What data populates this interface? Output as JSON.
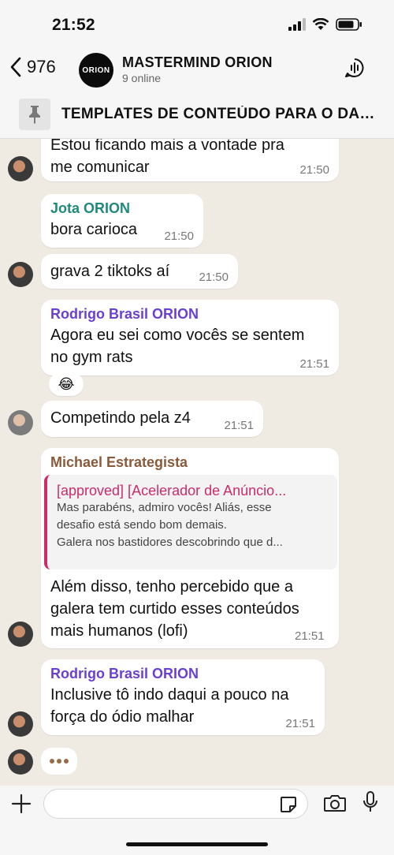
{
  "status": {
    "time": "21:52"
  },
  "header": {
    "back_count": "976",
    "group_avatar_label": "ORION",
    "group_name": "MASTERMIND ORION",
    "online": "9 online"
  },
  "pinned": {
    "text": "TEMPLATES DE CONTEÚDO PARA O DAS..."
  },
  "messages": [
    {
      "text_line1": "Estou ficando mais a vontade pra",
      "text_line2": "me comunicar",
      "time": "21:50"
    },
    {
      "sender": "Jota ORION",
      "text": "bora carioca",
      "time": "21:50"
    },
    {
      "text": "grava 2 tiktoks aí",
      "time": "21:50"
    },
    {
      "sender": "Rodrigo Brasil ORION",
      "text_line1": "Agora eu sei como vocês se sentem",
      "text_line2": "no gym rats",
      "time": "21:51"
    },
    {
      "reaction": "😂"
    },
    {
      "text": "Competindo pela z4",
      "time": "21:51"
    },
    {
      "sender": "Michael Estrategista",
      "reply_title": "[approved] [Acelerador de Anúncio...",
      "reply_line1": "Mas parabéns, admiro vocês! Aliás, esse",
      "reply_line2": "desafio está sendo bom demais.",
      "reply_line3": "Galera nos bastidores descobrindo que d...",
      "text_line1": "Além disso, tenho percebido que a",
      "text_line2": "galera tem curtido esses conteúdos",
      "text_line3": "mais humanos (lofi)",
      "time": "21:51"
    },
    {
      "sender": "Rodrigo Brasil ORION",
      "text_line1": "Inclusive tô indo daqui a pouco na",
      "text_line2": "força do ódio malhar",
      "time": "21:51"
    }
  ],
  "colors": {
    "jota": "#1f8a7a",
    "rodrigo": "#6a3fd1",
    "michael": "#8a5a3a",
    "reply_accent": "#cc2c6a"
  }
}
